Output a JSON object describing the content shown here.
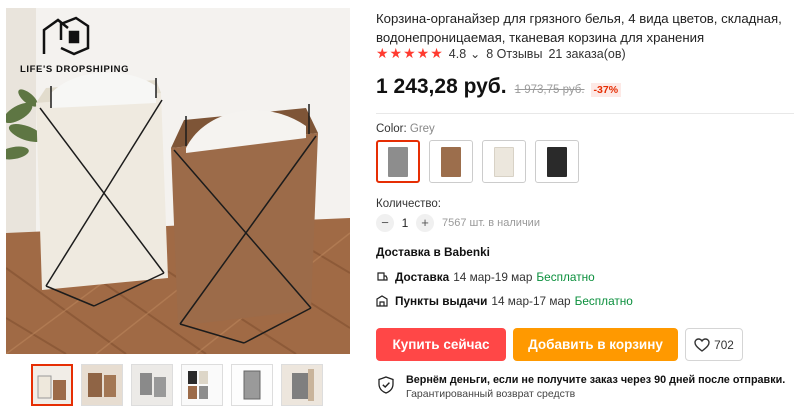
{
  "gallery": {
    "logo_text": "LIFE'S DROPSHIPING",
    "thumbnails": [
      "thumb-1",
      "thumb-2",
      "thumb-3",
      "thumb-4",
      "thumb-5",
      "thumb-6"
    ]
  },
  "product": {
    "title": "Корзина-органайзер для грязного белья, 4 вида цветов, складная, водонепроницаемая, тканевая корзина для хранения",
    "rating": "4.8",
    "reviews": "8 Отзывы",
    "orders": "21 заказа(ов)",
    "price": "1 243,28 руб.",
    "old_price": "1 973,75 руб.",
    "discount": "-37%"
  },
  "color": {
    "label": "Color:",
    "selected": "Grey",
    "swatches": [
      {
        "name": "Grey",
        "hex": "#8d8d8d"
      },
      {
        "name": "Brown",
        "hex": "#9c6e4c"
      },
      {
        "name": "Beige",
        "hex": "#ece7dd"
      },
      {
        "name": "Black",
        "hex": "#2a2a2a"
      }
    ]
  },
  "quantity": {
    "label": "Количество:",
    "minus": "−",
    "value": "1",
    "plus": "+",
    "stock": "7567 шт. в наличии"
  },
  "delivery": {
    "heading": "Доставка в Babenki",
    "options": [
      {
        "type": "Доставка",
        "dates": "14 мар-19 мар",
        "price": "Бесплатно"
      },
      {
        "type": "Пункты выдачи",
        "dates": "14 мар-17 мар",
        "price": "Бесплатно"
      }
    ]
  },
  "actions": {
    "buy_now": "Купить сейчас",
    "add_to_cart": "Добавить в корзину",
    "wishlist_count": "702"
  },
  "guarantee": {
    "title": "Вернём деньги, если не получите заказ через 90 дней после отправки.",
    "subtitle": "Гарантированный возврат средств"
  },
  "colors": {
    "accent_red": "#ff4747",
    "accent_orange": "#ff9900",
    "star_red": "#ff3b30",
    "free_green": "#0a8f3c"
  }
}
